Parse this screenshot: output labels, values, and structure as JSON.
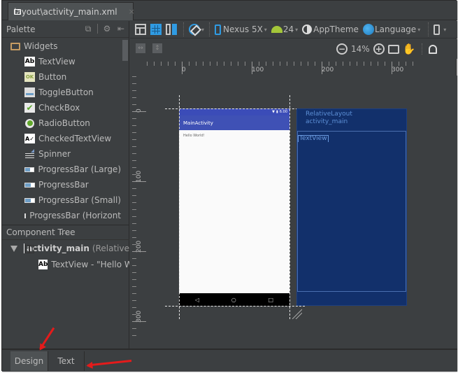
{
  "file_tab": {
    "label": "layout\\activity_main.xml",
    "close": "×"
  },
  "palette": {
    "title": "Palette",
    "groups": [
      {
        "label": "Widgets",
        "icon": "folder-icon"
      }
    ],
    "items": [
      {
        "label": "TextView",
        "icon": "textview-icon"
      },
      {
        "label": "Button",
        "icon": "button-icon"
      },
      {
        "label": "ToggleButton",
        "icon": "togglebutton-icon"
      },
      {
        "label": "CheckBox",
        "icon": "checkbox-icon"
      },
      {
        "label": "RadioButton",
        "icon": "radiobutton-icon"
      },
      {
        "label": "CheckedTextView",
        "icon": "checkedtextview-icon"
      },
      {
        "label": "Spinner",
        "icon": "spinner-icon"
      },
      {
        "label": "ProgressBar (Large)",
        "icon": "progressbar-icon"
      },
      {
        "label": "ProgressBar",
        "icon": "progressbar-icon"
      },
      {
        "label": "ProgressBar (Small)",
        "icon": "progressbar-icon"
      },
      {
        "label": "ProgressBar (Horizont",
        "icon": "progressbar-icon"
      }
    ]
  },
  "component_tree": {
    "title": "Component Tree",
    "root": {
      "name": "activity_main",
      "type": "(Relative"
    },
    "child": {
      "label": "TextView - \"Hello W"
    }
  },
  "toolbar": {
    "device": "Nexus 5X",
    "api": "24",
    "theme": "AppTheme",
    "language": "Language",
    "zoom": "14%"
  },
  "ruler": {
    "h_labels": [
      "0",
      "100",
      "200",
      "300"
    ],
    "v_labels": [
      "0",
      "100",
      "200",
      "300"
    ]
  },
  "preview": {
    "status_time": "6:00",
    "app_title": "MainActivity",
    "hello_text": "Hello World!",
    "nav_back": "◁",
    "nav_home": "○",
    "nav_recent": "□"
  },
  "blueprint": {
    "layout_type": "RelativeLayout",
    "layout_id": "activity_main",
    "textview_label": "TextView"
  },
  "bottom_tabs": [
    {
      "label": "Design",
      "active": true
    },
    {
      "label": "Text",
      "active": false
    }
  ],
  "colors": {
    "app_bar": "#3f51b5",
    "blueprint_bg": "#12306b",
    "annotation_arrow": "#e41b1b"
  }
}
